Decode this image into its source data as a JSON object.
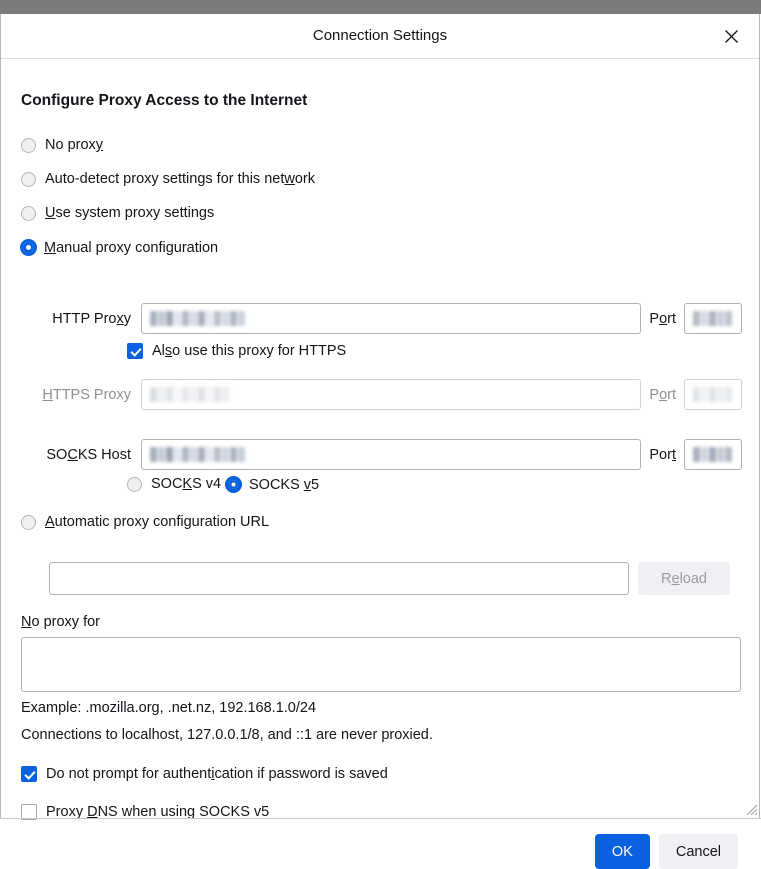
{
  "window": {
    "title": "Connection Settings",
    "close_icon": "close-icon"
  },
  "section": {
    "heading": "Configure Proxy Access to the Internet"
  },
  "proxy_mode": {
    "selected": "manual",
    "options": [
      {
        "id": "no-proxy",
        "label": "No prox",
        "accesskey": "y",
        "label_tail": "",
        "checked": false
      },
      {
        "id": "auto-detect",
        "label": "Auto-detect proxy settings for this net",
        "accesskey": "w",
        "label_tail": "ork",
        "checked": false
      },
      {
        "id": "use-system",
        "label": "",
        "accesskey": "U",
        "label_tail": "se system proxy settings",
        "checked": false
      },
      {
        "id": "manual",
        "label": "",
        "accesskey": "M",
        "label_tail": "anual proxy configuration",
        "checked": true
      }
    ]
  },
  "http_proxy": {
    "label_head": "HTTP Pro",
    "label_key": "x",
    "label_tail": "y",
    "value": "REDACTED",
    "port_label_head": "P",
    "port_label_key": "o",
    "port_label_tail": "rt",
    "port_value": "REDACTED",
    "enabled": true
  },
  "also_https": {
    "label_head": "Al",
    "label_key": "s",
    "label_tail": "o use this proxy for HTTPS",
    "checked": true
  },
  "https_proxy": {
    "label_head": "",
    "label_key": "H",
    "label_tail": "TTPS Proxy",
    "value": "REDACTED",
    "port_label_head": "P",
    "port_label_key": "o",
    "port_label_tail": "rt",
    "port_value": "REDACTED",
    "enabled": false
  },
  "socks_host": {
    "label_head": "SO",
    "label_key": "C",
    "label_tail": "KS Host",
    "value": "REDACTED",
    "port_label_head": "Por",
    "port_label_key": "t",
    "port_label_tail": "",
    "port_value": "REDACTED",
    "enabled": true
  },
  "socks_version": {
    "selected": "v5",
    "v4": {
      "head": "SOC",
      "key": "K",
      "tail": "S v4",
      "checked": false
    },
    "v5": {
      "head": "SOCKS ",
      "key": "v",
      "tail": "5",
      "checked": true
    }
  },
  "auto_config": {
    "radio_label_head": "",
    "radio_label_key": "A",
    "radio_label_tail": "utomatic proxy configuration URL",
    "checked": false,
    "url_value": "",
    "reload_head": "R",
    "reload_key": "e",
    "reload_tail": "load",
    "reload_enabled": false
  },
  "no_proxy_for": {
    "label_head": "",
    "label_key": "N",
    "label_tail": "o proxy for",
    "value": ""
  },
  "hints": {
    "example": "Example: .mozilla.org, .net.nz, 192.168.1.0/24",
    "localhost": "Connections to localhost, 127.0.0.1/8, and ::1 are never proxied."
  },
  "no_prompt_auth": {
    "label_head": "Do not prompt for authent",
    "label_key": "i",
    "label_tail": "cation if password is saved",
    "checked": true
  },
  "proxy_dns": {
    "label_head": "Proxy ",
    "label_key": "D",
    "label_tail": "NS when using SOCKS v5",
    "checked": false
  },
  "buttons": {
    "ok": "OK",
    "cancel": "Cancel"
  },
  "colors": {
    "accent": "#0a61e0",
    "disabled_text": "#8f8f94",
    "chrome": "#7a7a7a"
  }
}
